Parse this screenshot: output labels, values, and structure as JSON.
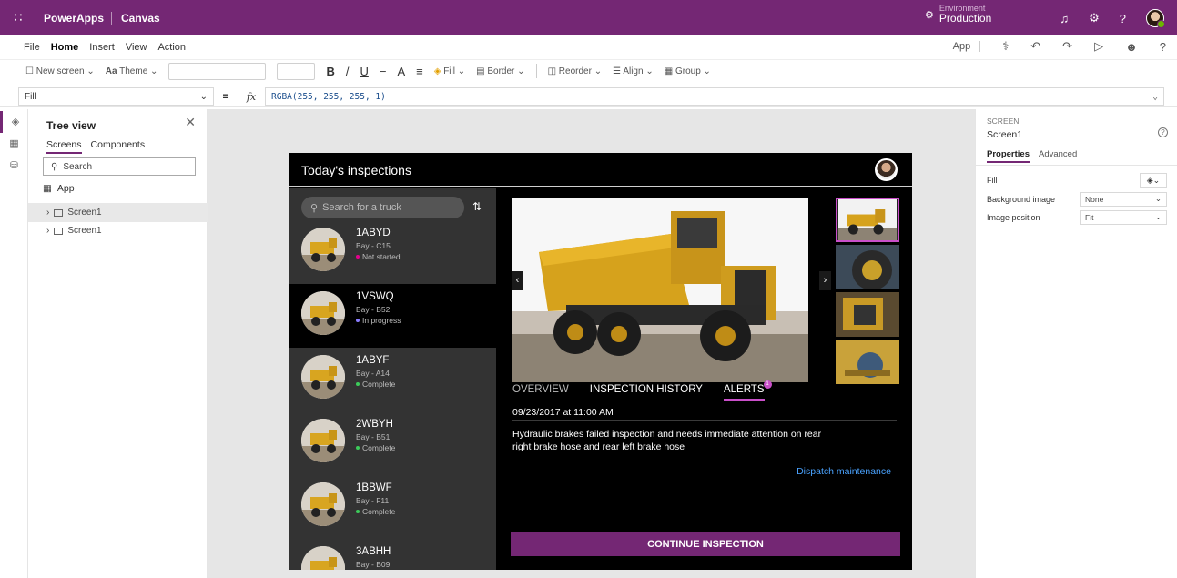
{
  "titlebar": {
    "app_name": "PowerApps",
    "app_mode": "Canvas",
    "environment_label": "Environment",
    "environment_value": "Production"
  },
  "menubar": {
    "items": [
      "File",
      "Home",
      "Insert",
      "View",
      "Action"
    ],
    "active": "Home",
    "right_label": "App"
  },
  "ribbon": {
    "new_screen": "New screen",
    "theme": "Theme",
    "bold": "B",
    "italic": "/",
    "underline": "U",
    "strike": "−",
    "font_size": "A",
    "align_text": "≡",
    "fill": "Fill",
    "border": "Border",
    "reorder": "Reorder",
    "align": "Align",
    "group": "Group"
  },
  "formula": {
    "property": "Fill",
    "equals": "=",
    "fx": "fx",
    "value": "RGBA(255, 255, 255, 1)"
  },
  "tree": {
    "title": "Tree view",
    "tabs": [
      "Screens",
      "Components"
    ],
    "search_placeholder": "Search",
    "app_node": "App",
    "screens": [
      "Screen1",
      "Screen1"
    ]
  },
  "properties": {
    "section_label": "SCREEN",
    "screen_name": "Screen1",
    "tabs": [
      "Properties",
      "Advanced"
    ],
    "fill_label": "Fill",
    "background_image_label": "Background image",
    "background_image_value": "None",
    "image_position_label": "Image position",
    "image_position_value": "Fit"
  },
  "app": {
    "title": "Today's inspections",
    "search_placeholder": "Search for a truck",
    "trucks": [
      {
        "id": "1ABYD",
        "bay": "Bay - C15",
        "status": "Not started",
        "status_color": "#e3008c"
      },
      {
        "id": "1VSWQ",
        "bay": "Bay - B52",
        "status": "In progress",
        "status_color": "#8a7cff"
      },
      {
        "id": "1ABYF",
        "bay": "Bay - A14",
        "status": "Complete",
        "status_color": "#3ccb5a"
      },
      {
        "id": "2WBYH",
        "bay": "Bay - B51",
        "status": "Complete",
        "status_color": "#3ccb5a"
      },
      {
        "id": "1BBWF",
        "bay": "Bay - F11",
        "status": "Complete",
        "status_color": "#3ccb5a"
      },
      {
        "id": "3ABHH",
        "bay": "Bay - B09",
        "status": "",
        "status_color": "#3ccb5a"
      }
    ],
    "tabs": [
      "OVERVIEW",
      "INSPECTION HISTORY",
      "ALERTS"
    ],
    "alert_badge": "1",
    "alert_time": "09/23/2017 at 11:00 AM",
    "alert_text": "Hydraulic brakes failed inspection and needs immediate attention on rear right brake hose and rear left brake hose",
    "dispatch_link": "Dispatch maintenance",
    "continue_button": "CONTINUE INSPECTION"
  },
  "colors": {
    "brand": "#742774",
    "accent": "#c94fc9",
    "link": "#4aa3ff"
  }
}
